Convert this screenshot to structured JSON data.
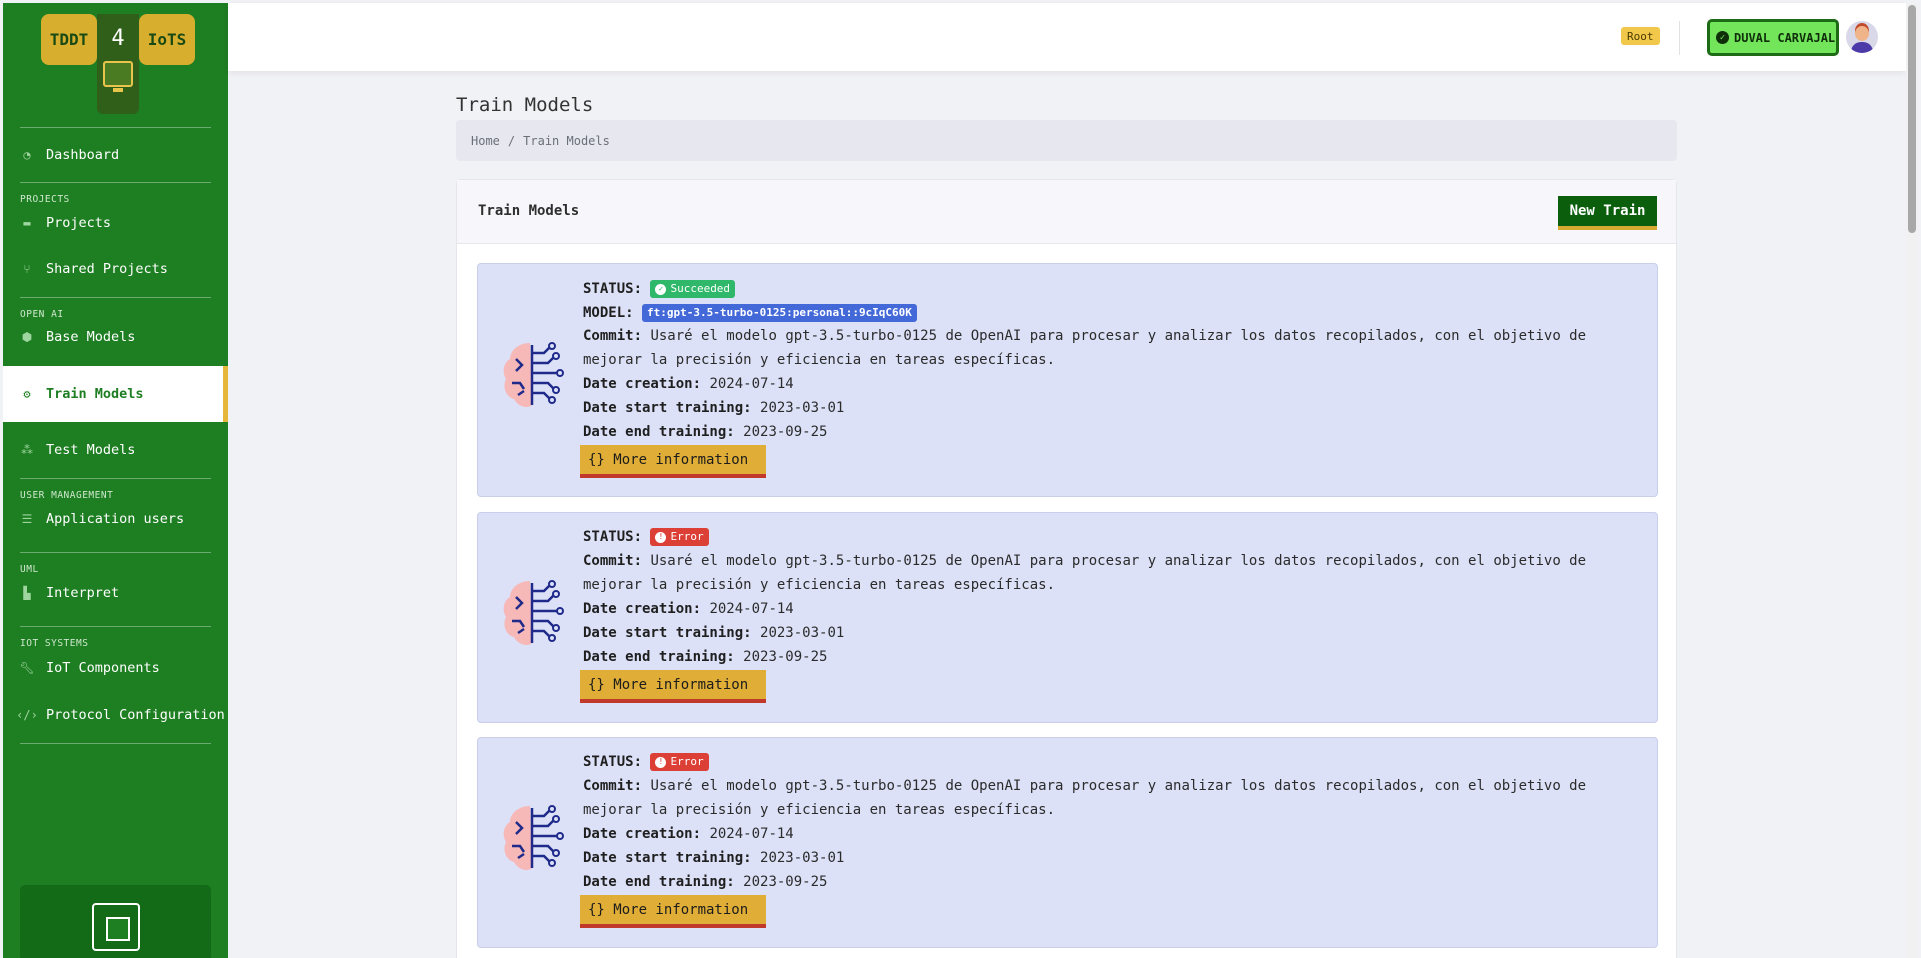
{
  "brand": {
    "left": "TDDT",
    "middle": "4",
    "right": "IoTS"
  },
  "sidebar": {
    "items": [
      {
        "section": "",
        "label": "Dashboard",
        "icon": "dashboard-icon",
        "active": false
      },
      {
        "section": "PROJECTS",
        "label": "Projects",
        "icon": "folder-icon",
        "active": false
      },
      {
        "section": "",
        "label": "Shared Projects",
        "icon": "branch-icon",
        "active": false
      },
      {
        "section": "OPEN AI",
        "label": "Base Models",
        "icon": "cube-icon",
        "active": false
      },
      {
        "section": "",
        "label": "Train Models",
        "icon": "gear-icon",
        "active": true
      },
      {
        "section": "",
        "label": "Test Models",
        "icon": "cubes-icon",
        "active": false
      },
      {
        "section": "USER MANAGEMENT",
        "label": "Application users",
        "icon": "server-icon",
        "active": false
      },
      {
        "section": "UML",
        "label": "Interpret",
        "icon": "diagram-icon",
        "active": false
      },
      {
        "section": "IOT SYSTEMS",
        "label": "IoT Components",
        "icon": "wrench-icon",
        "active": false
      },
      {
        "section": "",
        "label": "Protocol Configuration",
        "icon": "code-icon",
        "active": false
      }
    ]
  },
  "topbar": {
    "role_badge": "Root",
    "user_name": "DUVAL CARVAJAL"
  },
  "page": {
    "title": "Train Models",
    "breadcrumb": {
      "home": "Home",
      "current": "Train Models"
    },
    "card_title": "Train Models",
    "new_button": "New Train"
  },
  "labels": {
    "status": "STATUS:",
    "model": "MODEL:",
    "commit": "Commit:",
    "date_creation": "Date creation:",
    "date_start": "Date start training:",
    "date_end": "Date end training:",
    "more": "{} More information"
  },
  "trainings": [
    {
      "status": "Succeeded",
      "status_type": "success",
      "model": "ft:gpt-3.5-turbo-0125:personal::9cIqC60K",
      "commit_line1": "Usaré el modelo gpt-3.5-turbo-0125 de OpenAI para procesar y analizar los datos recopilados, con el objetivo de",
      "commit_line2": "mejorar la precisión y eficiencia en tareas específicas.",
      "date_creation": "2024-07-14",
      "date_start": "2023-03-01",
      "date_end": "2023-09-25"
    },
    {
      "status": "Error",
      "status_type": "error",
      "model": "",
      "commit_line1": "Usaré el modelo gpt-3.5-turbo-0125 de OpenAI para procesar y analizar los datos recopilados, con el objetivo de",
      "commit_line2": "mejorar la precisión y eficiencia en tareas específicas.",
      "date_creation": "2024-07-14",
      "date_start": "2023-03-01",
      "date_end": "2023-09-25"
    },
    {
      "status": "Error",
      "status_type": "error",
      "model": "",
      "commit_line1": "Usaré el modelo gpt-3.5-turbo-0125 de OpenAI para procesar y analizar los datos recopilados, con el objetivo de",
      "commit_line2": "mejorar la precisión y eficiencia en tareas específicas.",
      "date_creation": "2024-07-14",
      "date_start": "2023-03-01",
      "date_end": "2023-09-25"
    }
  ],
  "colors": {
    "sidebar": "#1e7e22",
    "accent": "#e6b63b",
    "card_bg": "#dce1f7",
    "success": "#2fb86a",
    "error": "#dc3f35",
    "model_badge": "#4368d8"
  }
}
